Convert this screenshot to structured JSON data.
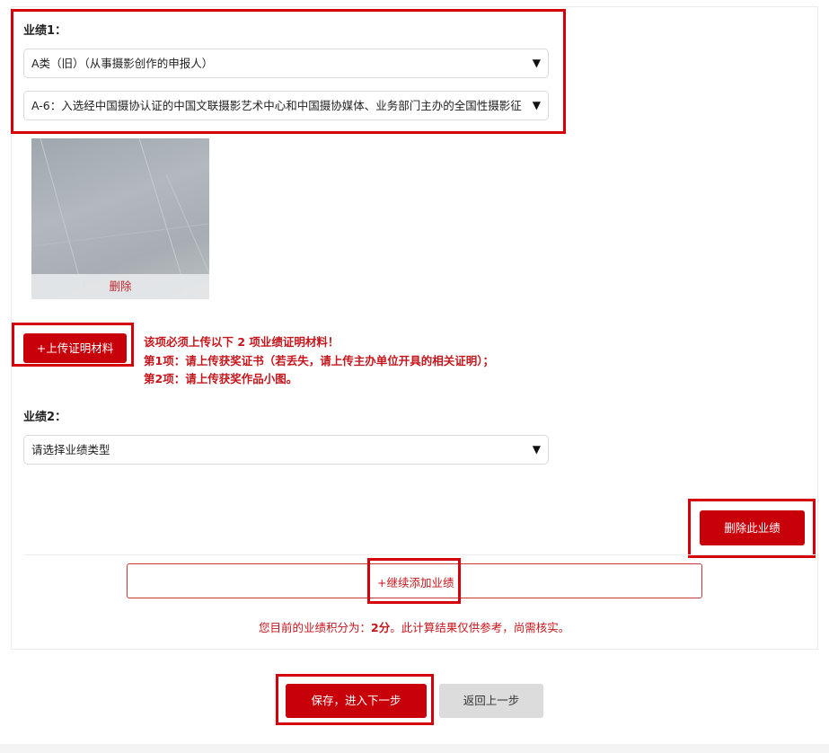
{
  "achievement1": {
    "label": "业绩1：",
    "category_select": {
      "value": "A类（旧）（从事摄影创作的申报人）"
    },
    "item_select": {
      "value": "A-6：入选经中国摄协认证的中国文联摄影艺术中心和中国摄协媒体、业务部门主办的全国性摄影征"
    },
    "thumbnail": {
      "delete_label": "删除"
    },
    "upload_button_label": "+上传证明材料",
    "notice": {
      "line1": "该项必须上传以下 2 项业绩证明材料！",
      "line2": "第1项：请上传获奖证书（若丢失，请上传主办单位开具的相关证明）；",
      "line3": "第2项：请上传获奖作品小图。"
    }
  },
  "achievement2": {
    "label": "业绩2：",
    "type_select": {
      "value": "请选择业绩类型"
    }
  },
  "delete_achievement_label": "删除此业绩",
  "add_more_label": "+继续添加业绩",
  "score": {
    "prefix": "您目前的业绩积分为：",
    "value": "2分",
    "suffix": "。此计算结果仅供参考，尚需核实。"
  },
  "footer": {
    "save_label": "保存，进入下一步",
    "back_label": "返回上一步"
  },
  "icons": {
    "select_caret": "caret-down-icon"
  },
  "colors": {
    "accent": "#c8000a",
    "highlight": "#d6000b",
    "text_red": "#c4161c"
  }
}
